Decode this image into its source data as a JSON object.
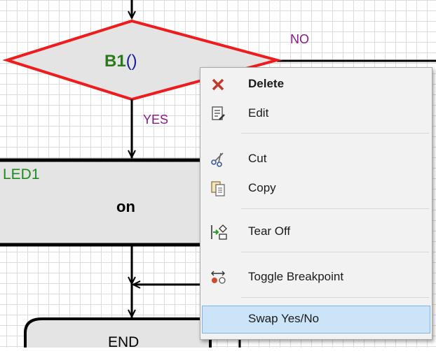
{
  "flowchart": {
    "decision_call": "B1",
    "decision_parens": "()",
    "no_label": "NO",
    "yes_label": "YES",
    "block_name": "LED1",
    "block_action": "on",
    "end_label": "END"
  },
  "context_menu": {
    "items": [
      {
        "label": "Delete",
        "icon": "delete-x-icon"
      },
      {
        "label": "Edit",
        "icon": "edit-icon"
      },
      {
        "label": "Cut",
        "icon": "scissors-icon"
      },
      {
        "label": "Copy",
        "icon": "copy-icon"
      },
      {
        "label": "Tear Off",
        "icon": "tear-off-icon"
      },
      {
        "label": "Toggle Breakpoint",
        "icon": "breakpoint-icon"
      },
      {
        "label": "Swap Yes/No",
        "icon": ""
      }
    ]
  },
  "colors": {
    "decision_border": "#ee1c1c",
    "node_fill": "#e4e4e4",
    "yes_no_label": "#8a1a8a",
    "block_name": "#1f8a1f",
    "call_name": "#2a7a1a",
    "paren": "#1a1aa0",
    "highlight": "#cce4f7"
  }
}
